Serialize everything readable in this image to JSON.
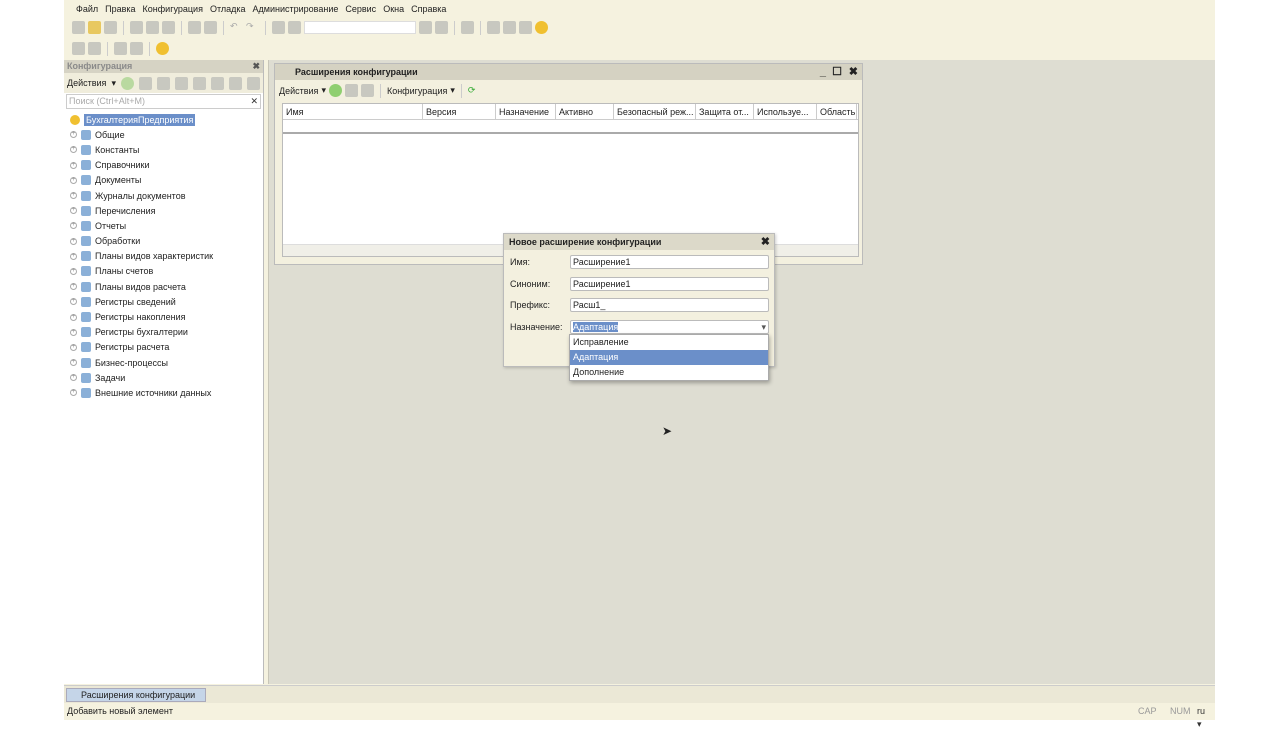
{
  "menu": [
    "Файл",
    "Правка",
    "Конфигурация",
    "Отладка",
    "Администрирование",
    "Сервис",
    "Окна",
    "Справка"
  ],
  "panel": {
    "title": "Конфигурация",
    "actions": "Действия",
    "search_placeholder": "Поиск (Ctrl+Alt+M)",
    "root": "БухгалтерияПредприятия",
    "items": [
      "Общие",
      "Константы",
      "Справочники",
      "Документы",
      "Журналы документов",
      "Перечисления",
      "Отчеты",
      "Обработки",
      "Планы видов характеристик",
      "Планы счетов",
      "Планы видов расчета",
      "Регистры сведений",
      "Регистры накопления",
      "Регистры бухгалтерии",
      "Регистры расчета",
      "Бизнес-процессы",
      "Задачи",
      "Внешние источники данных"
    ]
  },
  "ext_window": {
    "title": "Расширения конфигурации",
    "actions": "Действия",
    "config": "Конфигурация",
    "columns": [
      "Имя",
      "Версия",
      "Назначение",
      "Активно",
      "Безопасный реж...",
      "Защита от...",
      "Используе...",
      "Область ..."
    ]
  },
  "dialog": {
    "title": "Новое расширение конфигурации",
    "fields": [
      {
        "label": "Имя:",
        "value": "Расширение1"
      },
      {
        "label": "Синоним:",
        "value": "Расширение1"
      },
      {
        "label": "Префикс:",
        "value": "Расш1_"
      },
      {
        "label": "Назначение:",
        "value": "Адаптация"
      }
    ],
    "options": [
      "Исправление",
      "Адаптация",
      "Дополнение"
    ],
    "selected": "Адаптация"
  },
  "taskbar": {
    "item": "Расширения конфигурации"
  },
  "status": {
    "text": "Добавить новый элемент",
    "cap": "CAP",
    "num": "NUM",
    "lang": "ru ▾"
  },
  "colors": {
    "selection": "#6b8fc9",
    "background": "#f5f2df"
  }
}
